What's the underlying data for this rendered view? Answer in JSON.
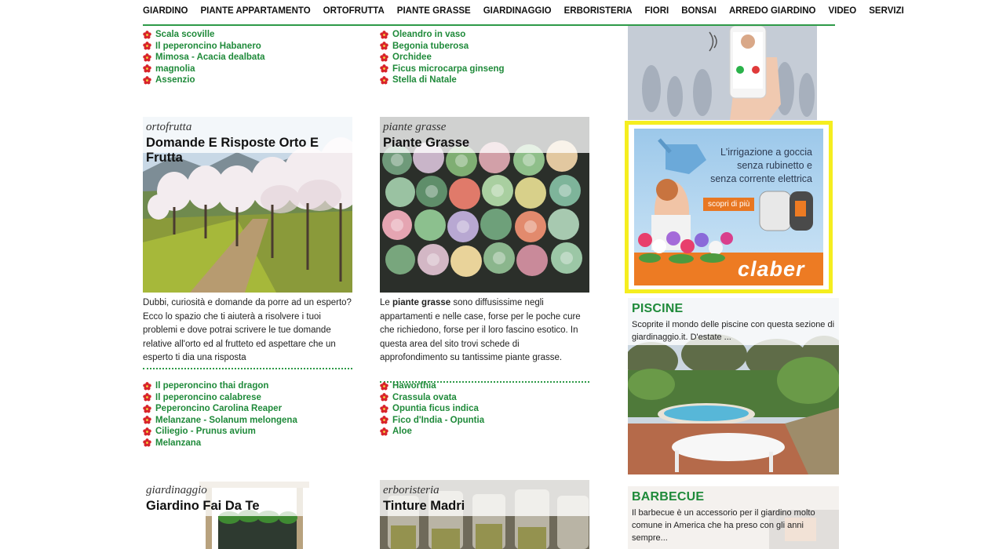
{
  "nav": {
    "items": [
      "GIARDINO",
      "PIANTE APPARTAMENTO",
      "ORTOFRUTTA",
      "PIANTE GRASSE",
      "GIARDINAGGIO",
      "ERBORISTERIA",
      "FIORI",
      "BONSAI",
      "ARREDO GIARDINO",
      "VIDEO",
      "SERVIZI"
    ]
  },
  "col1": {
    "top_bullets": [
      "Scala scoville",
      "Il peperoncino Habanero",
      "Mimosa - Acacia dealbata",
      "magnolia",
      "Assenzio"
    ],
    "card": {
      "category": "ortofrutta",
      "title": "Domande E Risposte Orto E Frutta",
      "description": "Dubbi, curiosità e domande da porre ad un esperto? Ecco lo spazio che ti aiuterà a risolvere i tuoi problemi e dove potrai scrivere le tue domande relative all'orto ed al frutteto ed aspettare che un esperto ti dia una risposta"
    },
    "bullets": [
      "Il peperoncino thai dragon",
      "Il peperoncino calabrese",
      "Peperoncino Carolina Reaper",
      "Melanzane - Solanum melongena",
      "Ciliegio - Prunus avium",
      "Melanzana"
    ],
    "card2": {
      "category": "giardinaggio",
      "title": "Giardino Fai Da Te"
    }
  },
  "col2": {
    "top_bullets": [
      "Oleandro in vaso",
      "Begonia tuberosa",
      "Orchidee",
      "Ficus microcarpa ginseng",
      "Stella di Natale"
    ],
    "card": {
      "category": "piante grasse",
      "title": "Piante Grasse",
      "desc_before": "Le ",
      "desc_bold": "piante grasse",
      "desc_after": " sono diffusissime negli appartamenti e nelle case, forse per le poche cure che richiedono, forse per il loro fascino esotico. In questa area del sito trovi schede di approfondimento su tantissime piante grasse."
    },
    "bullets": [
      "Haworthia",
      "Crassula ovata",
      "Opuntia ficus indica",
      "Fico d'India - Opuntia",
      "Aloe"
    ],
    "card2": {
      "category": "erboristeria",
      "title": "Tinture Madri"
    }
  },
  "sidebar": {
    "ad": {
      "line1": "L'irrigazione a goccia",
      "line2": "senza rubinetto e",
      "line3": "senza corrente elettrica",
      "button": "scopri di più",
      "brand": "claber"
    },
    "piscine": {
      "heading": "PISCINE",
      "text": "Scoprite il mondo delle piscine con questa sezione di giardinaggio.it. D'estate ..."
    },
    "barbecue": {
      "heading": "BARBECUE",
      "text": "Il barbecue è un accessorio per il giardino molto comune in America che ha preso con gli anni sempre..."
    }
  },
  "colors": {
    "accent_green": "#1f8a3a",
    "nav_rule": "#2e9a48",
    "ad_border": "#f5ee1f"
  }
}
